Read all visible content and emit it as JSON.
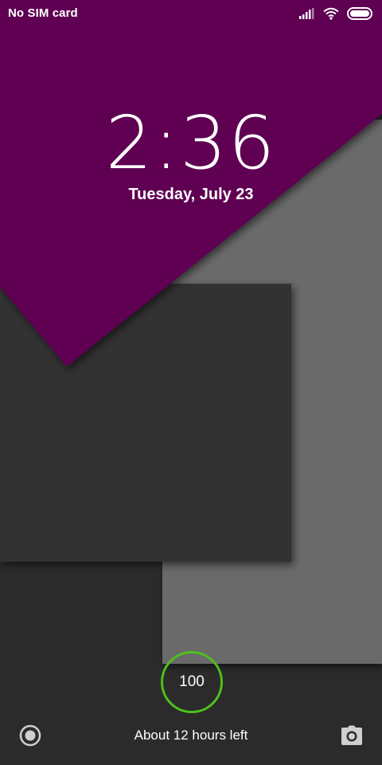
{
  "status_bar": {
    "carrier": "No SIM card",
    "icons": [
      "signal-icon",
      "wifi-icon",
      "battery-icon"
    ]
  },
  "lock_screen": {
    "time": "2:36",
    "date": "Tuesday, July 23"
  },
  "battery": {
    "level": "100",
    "time_left": "About 12 hours left",
    "ring_color": "#4ec21a"
  },
  "shortcuts": {
    "left_icon": "record-icon",
    "right_icon": "camera-icon"
  },
  "colors": {
    "purple": "#5e0052",
    "dark_gray": "#333333",
    "mid_gray": "#6b6b6b",
    "background": "#2b2b2b"
  }
}
